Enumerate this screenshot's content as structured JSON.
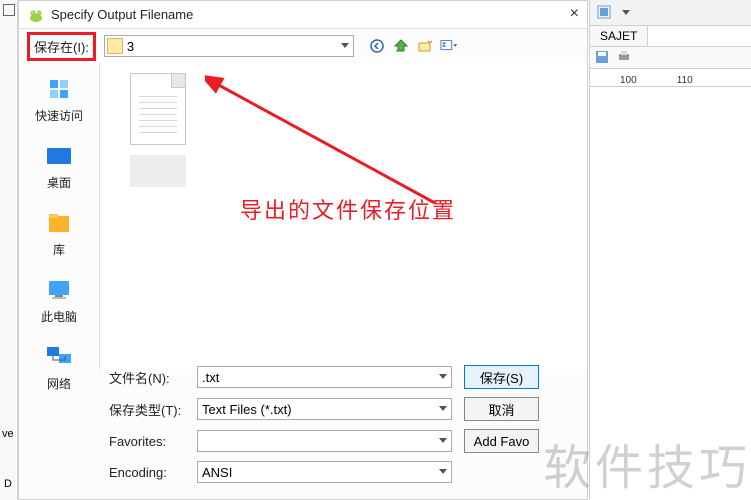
{
  "dialog": {
    "title": "Specify Output Filename",
    "close_symbol": "×",
    "save_in_label": "保存在(I):",
    "folder_selected": "3",
    "file_row": {
      "filename_label": "文件名(N):",
      "filename_value": ".txt",
      "filetype_label": "保存类型(T):",
      "filetype_value": "Text Files (*.txt)",
      "favorites_label": "Favorites:",
      "encoding_label": "Encoding:",
      "encoding_value": "ANSI"
    },
    "buttons": {
      "save": "保存(S)",
      "cancel": "取消",
      "add_favorite": "Add Favo"
    }
  },
  "places": [
    {
      "label": "快速访问",
      "color": "#3ea3ff"
    },
    {
      "label": "桌面",
      "color": "#1f7ae0"
    },
    {
      "label": "库",
      "color": "#ffb32b"
    },
    {
      "label": "此电脑",
      "color": "#3ea3ff"
    },
    {
      "label": "网络",
      "color": "#1f7ae0"
    }
  ],
  "annotation": "导出的文件保存位置",
  "side": {
    "tab_label": "SAJET",
    "ruler_marks": [
      "100",
      "110"
    ]
  },
  "watermark": "软件技巧",
  "leftstrip": {
    "ve": "ve",
    "d": "D"
  }
}
